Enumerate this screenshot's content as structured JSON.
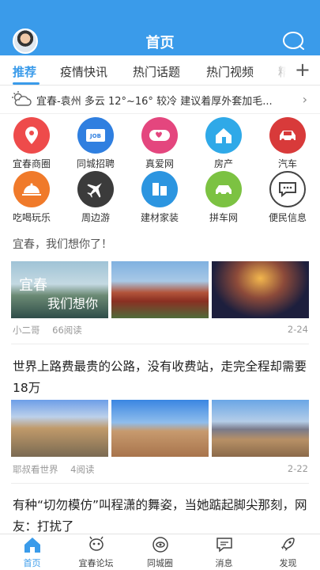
{
  "header": {
    "title": "首页",
    "avatar": "user-avatar",
    "search_icon": "search-icon"
  },
  "tabs": [
    {
      "label": "推荐",
      "active": true
    },
    {
      "label": "疫情快讯",
      "active": false
    },
    {
      "label": "热门话题",
      "active": false
    },
    {
      "label": "热门视频",
      "active": false
    },
    {
      "label": "精",
      "active": false
    }
  ],
  "tabs_more": "+",
  "weather": {
    "text": "宜春-袁州 多云 12°~16° 较冷 建议着厚外套加毛...",
    "icon": "partly-cloudy-icon"
  },
  "quick_links": [
    {
      "label": "宜春商圈",
      "icon": "location-pin-icon",
      "color": "#ee4b4b"
    },
    {
      "label": "同城招聘",
      "icon": "job-card-icon",
      "color": "#2f7fe0"
    },
    {
      "label": "真爱网",
      "icon": "heart-badge-icon",
      "color": "#e4467e"
    },
    {
      "label": "房产",
      "icon": "house-icon",
      "color": "#2fa9e8"
    },
    {
      "label": "汽车",
      "icon": "car-icon",
      "color": "#d83a3a"
    },
    {
      "label": "吃喝玩乐",
      "icon": "food-cloche-icon",
      "color": "#f07a2a"
    },
    {
      "label": "周边游",
      "icon": "airplane-icon",
      "color": "#3b3b3b"
    },
    {
      "label": "建材家装",
      "icon": "building-blocks-icon",
      "color": "#2c95e0"
    },
    {
      "label": "拼车网",
      "icon": "carpool-icon",
      "color": "#7cc242"
    },
    {
      "label": "便民信息",
      "icon": "message-bubble-icon",
      "color": "#444444"
    }
  ],
  "articles": [
    {
      "title": "宜春，我们想你了！",
      "thumb_overlay_1": "宜春",
      "thumb_overlay_2": "我们想你",
      "author": "小二哥",
      "reads": "66阅读",
      "date": "2-24"
    },
    {
      "title": "世界上路费最贵的公路，没有收费站，走完全程却需要18万",
      "author": "耶叔看世界",
      "reads": "4阅读",
      "date": "2-22"
    },
    {
      "title": "有种“切勿模仿”叫程潇的舞姿，当她踮起脚尖那刻，网友：打扰了"
    }
  ],
  "bottom_nav": [
    {
      "label": "首页",
      "icon": "home-icon",
      "active": true
    },
    {
      "label": "宜春论坛",
      "icon": "forum-alien-icon",
      "active": false
    },
    {
      "label": "同城圈",
      "icon": "circle-eye-icon",
      "active": false
    },
    {
      "label": "消息",
      "icon": "chat-bubble-icon",
      "active": false
    },
    {
      "label": "发现",
      "icon": "discover-rocket-icon",
      "active": false
    }
  ],
  "colors": {
    "accent": "#3a9bea",
    "text": "#222222",
    "muted": "#999999"
  }
}
